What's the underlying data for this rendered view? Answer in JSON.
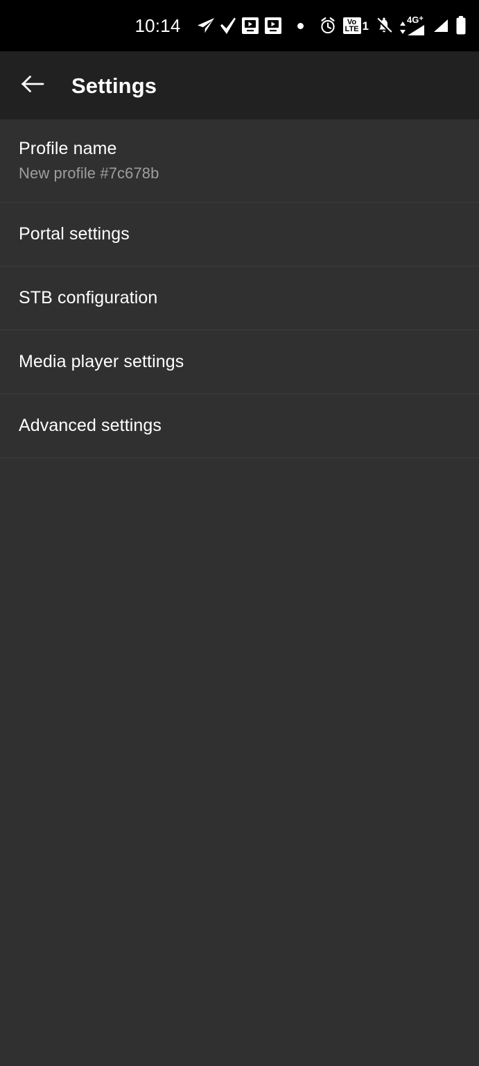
{
  "status_bar": {
    "time": "10:14",
    "icons": [
      {
        "name": "telegram-send-icon",
        "label": "telegram"
      },
      {
        "name": "checkmark-icon",
        "label": "check"
      },
      {
        "name": "screen-cast-play-icon",
        "label": "media-cast-1"
      },
      {
        "name": "screen-cast-play-icon-2",
        "label": "media-cast-2"
      },
      {
        "name": "notification-dot-icon",
        "label": "dot"
      },
      {
        "name": "alarm-clock-icon",
        "label": "alarm"
      },
      {
        "name": "volte-icon",
        "label": "VoLTE"
      },
      {
        "name": "notifications-muted-icon",
        "label": "bell-off"
      },
      {
        "name": "mobile-signal-4gplus-icon",
        "label": "4G+"
      },
      {
        "name": "mobile-signal-icon",
        "label": "signal"
      },
      {
        "name": "battery-icon",
        "label": "battery"
      }
    ],
    "volte": {
      "line1": "Vo",
      "line2": "LTE",
      "sim": "1"
    },
    "network_label": "4G",
    "network_plus": "+"
  },
  "app_bar": {
    "back_label": "Back",
    "title": "Settings"
  },
  "settings": {
    "items": [
      {
        "title": "Profile name",
        "subtitle": "New profile #7c678b"
      },
      {
        "title": "Portal settings",
        "subtitle": null
      },
      {
        "title": "STB configuration",
        "subtitle": null
      },
      {
        "title": "Media player settings",
        "subtitle": null
      },
      {
        "title": "Advanced settings",
        "subtitle": null
      }
    ]
  },
  "colors": {
    "status_bar_bg": "#000000",
    "app_bar_bg": "#212121",
    "list_bg": "#303030",
    "divider": "#3d3d3d",
    "primary_text": "#ffffff",
    "secondary_text": "#9e9e9e"
  }
}
